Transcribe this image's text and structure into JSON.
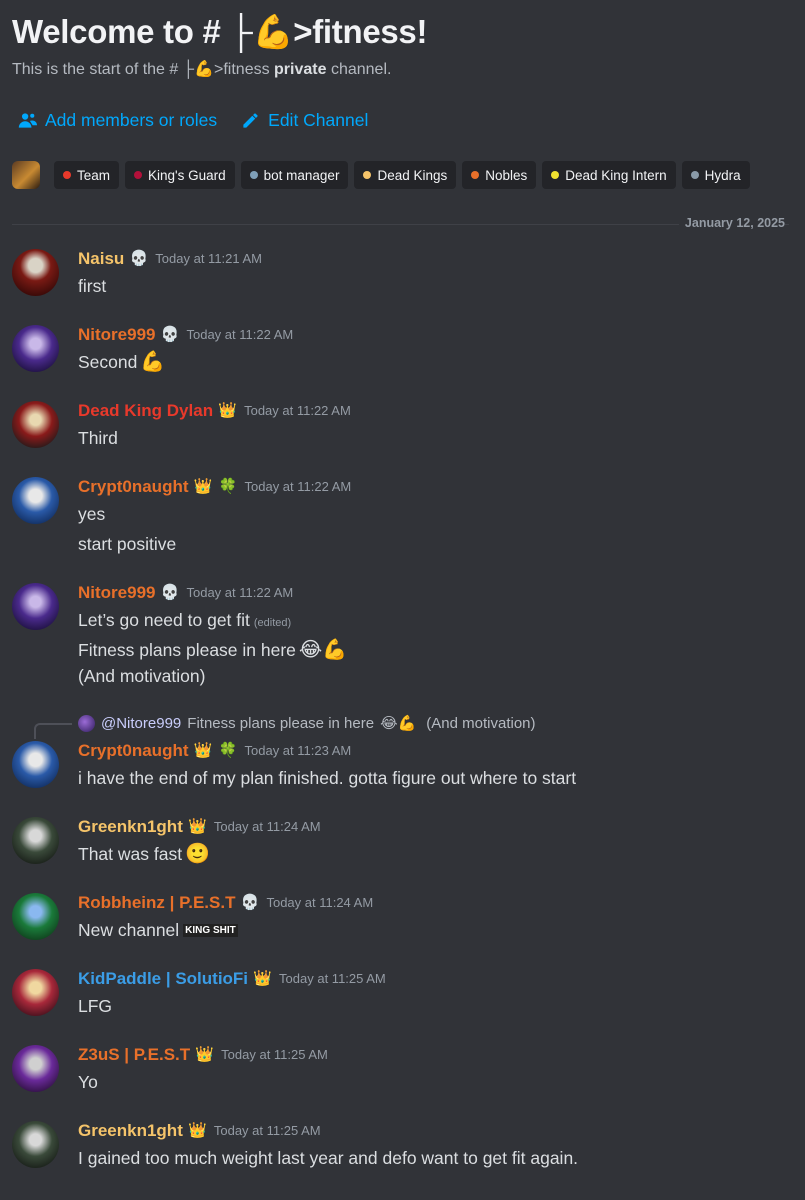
{
  "header": {
    "title": "Welcome to # ├💪>fitness!",
    "subtitle_prefix": "This is the start of the # ├💪>fitness ",
    "subtitle_bold": "private",
    "subtitle_suffix": " channel."
  },
  "actions": {
    "add_members": "Add members or roles",
    "edit_channel": "Edit Channel"
  },
  "roles": [
    {
      "label": "Team",
      "color": "#e8392b"
    },
    {
      "label": "King's Guard",
      "color": "#b3103a"
    },
    {
      "label": "bot manager",
      "color": "#7f9fb8"
    },
    {
      "label": "Dead Kings",
      "color": "#f5c46a"
    },
    {
      "label": "Nobles",
      "color": "#e8702a"
    },
    {
      "label": "Dead King Intern",
      "color": "#f0e130"
    },
    {
      "label": "Hydra",
      "color": "#8a9aa8"
    }
  ],
  "divider_date": "January 12, 2025",
  "reply": {
    "mention": "@Nitore999",
    "text": "Fitness plans please in here",
    "emoji": "😂💪",
    "text2": "(And motivation)"
  },
  "messages": [
    {
      "user": "Naisu",
      "color": "#f5c46a",
      "badge": "💀",
      "time": "Today at 11:21 AM",
      "lines": [
        "first"
      ]
    },
    {
      "user": "Nitore999",
      "color": "#e8702a",
      "badge": "💀",
      "time": "Today at 11:22 AM",
      "lines": [
        "Second",
        "💪"
      ]
    },
    {
      "user": "Dead King Dylan",
      "color": "#e8392b",
      "badge": "👑",
      "time": "Today at 11:22 AM",
      "lines": [
        "Third"
      ]
    },
    {
      "user": "Crypt0naught",
      "color": "#e8702a",
      "badge": "👑",
      "badge2": "🍀",
      "time": "Today at 11:22 AM",
      "lines": [
        "yes",
        "start positive"
      ]
    },
    {
      "user": "Nitore999",
      "color": "#e8702a",
      "badge": "💀",
      "time": "Today at 11:22 AM",
      "lines": [
        "Let’s go need to get fit",
        "(edited)",
        "Fitness plans please in here",
        "😂💪",
        "(And motivation)"
      ]
    },
    {
      "user": "Crypt0naught",
      "color": "#e8702a",
      "badge": "👑",
      "badge2": "🍀",
      "time": "Today at 11:23 AM",
      "lines": [
        "i have the end of my plan finished. gotta figure out where to start"
      ]
    },
    {
      "user": "Greenkn1ght",
      "color": "#f5c46a",
      "badge": "👑",
      "time": "Today at 11:24 AM",
      "lines": [
        "That was fast",
        "🙂"
      ]
    },
    {
      "user": "Robbheinz | P.E.S.T",
      "color": "#e8702a",
      "badge": "💀",
      "time": "Today at 11:24 AM",
      "lines": [
        "New channel",
        "KING SHIT"
      ]
    },
    {
      "user": "KidPaddle | SolutioFi",
      "color": "#3b9de6",
      "badge": "👑",
      "time": "Today at 11:25 AM",
      "lines": [
        "LFG"
      ]
    },
    {
      "user": "Z3uS | P.E.S.T",
      "color": "#e8702a",
      "badge": "👑",
      "time": "Today at 11:25 AM",
      "lines": [
        "Yo"
      ]
    },
    {
      "user": "Greenkn1ght",
      "color": "#f5c46a",
      "badge": "👑",
      "time": "Today at 11:25 AM",
      "lines": [
        "I gained too much weight last year and defo want to get fit again."
      ]
    }
  ]
}
